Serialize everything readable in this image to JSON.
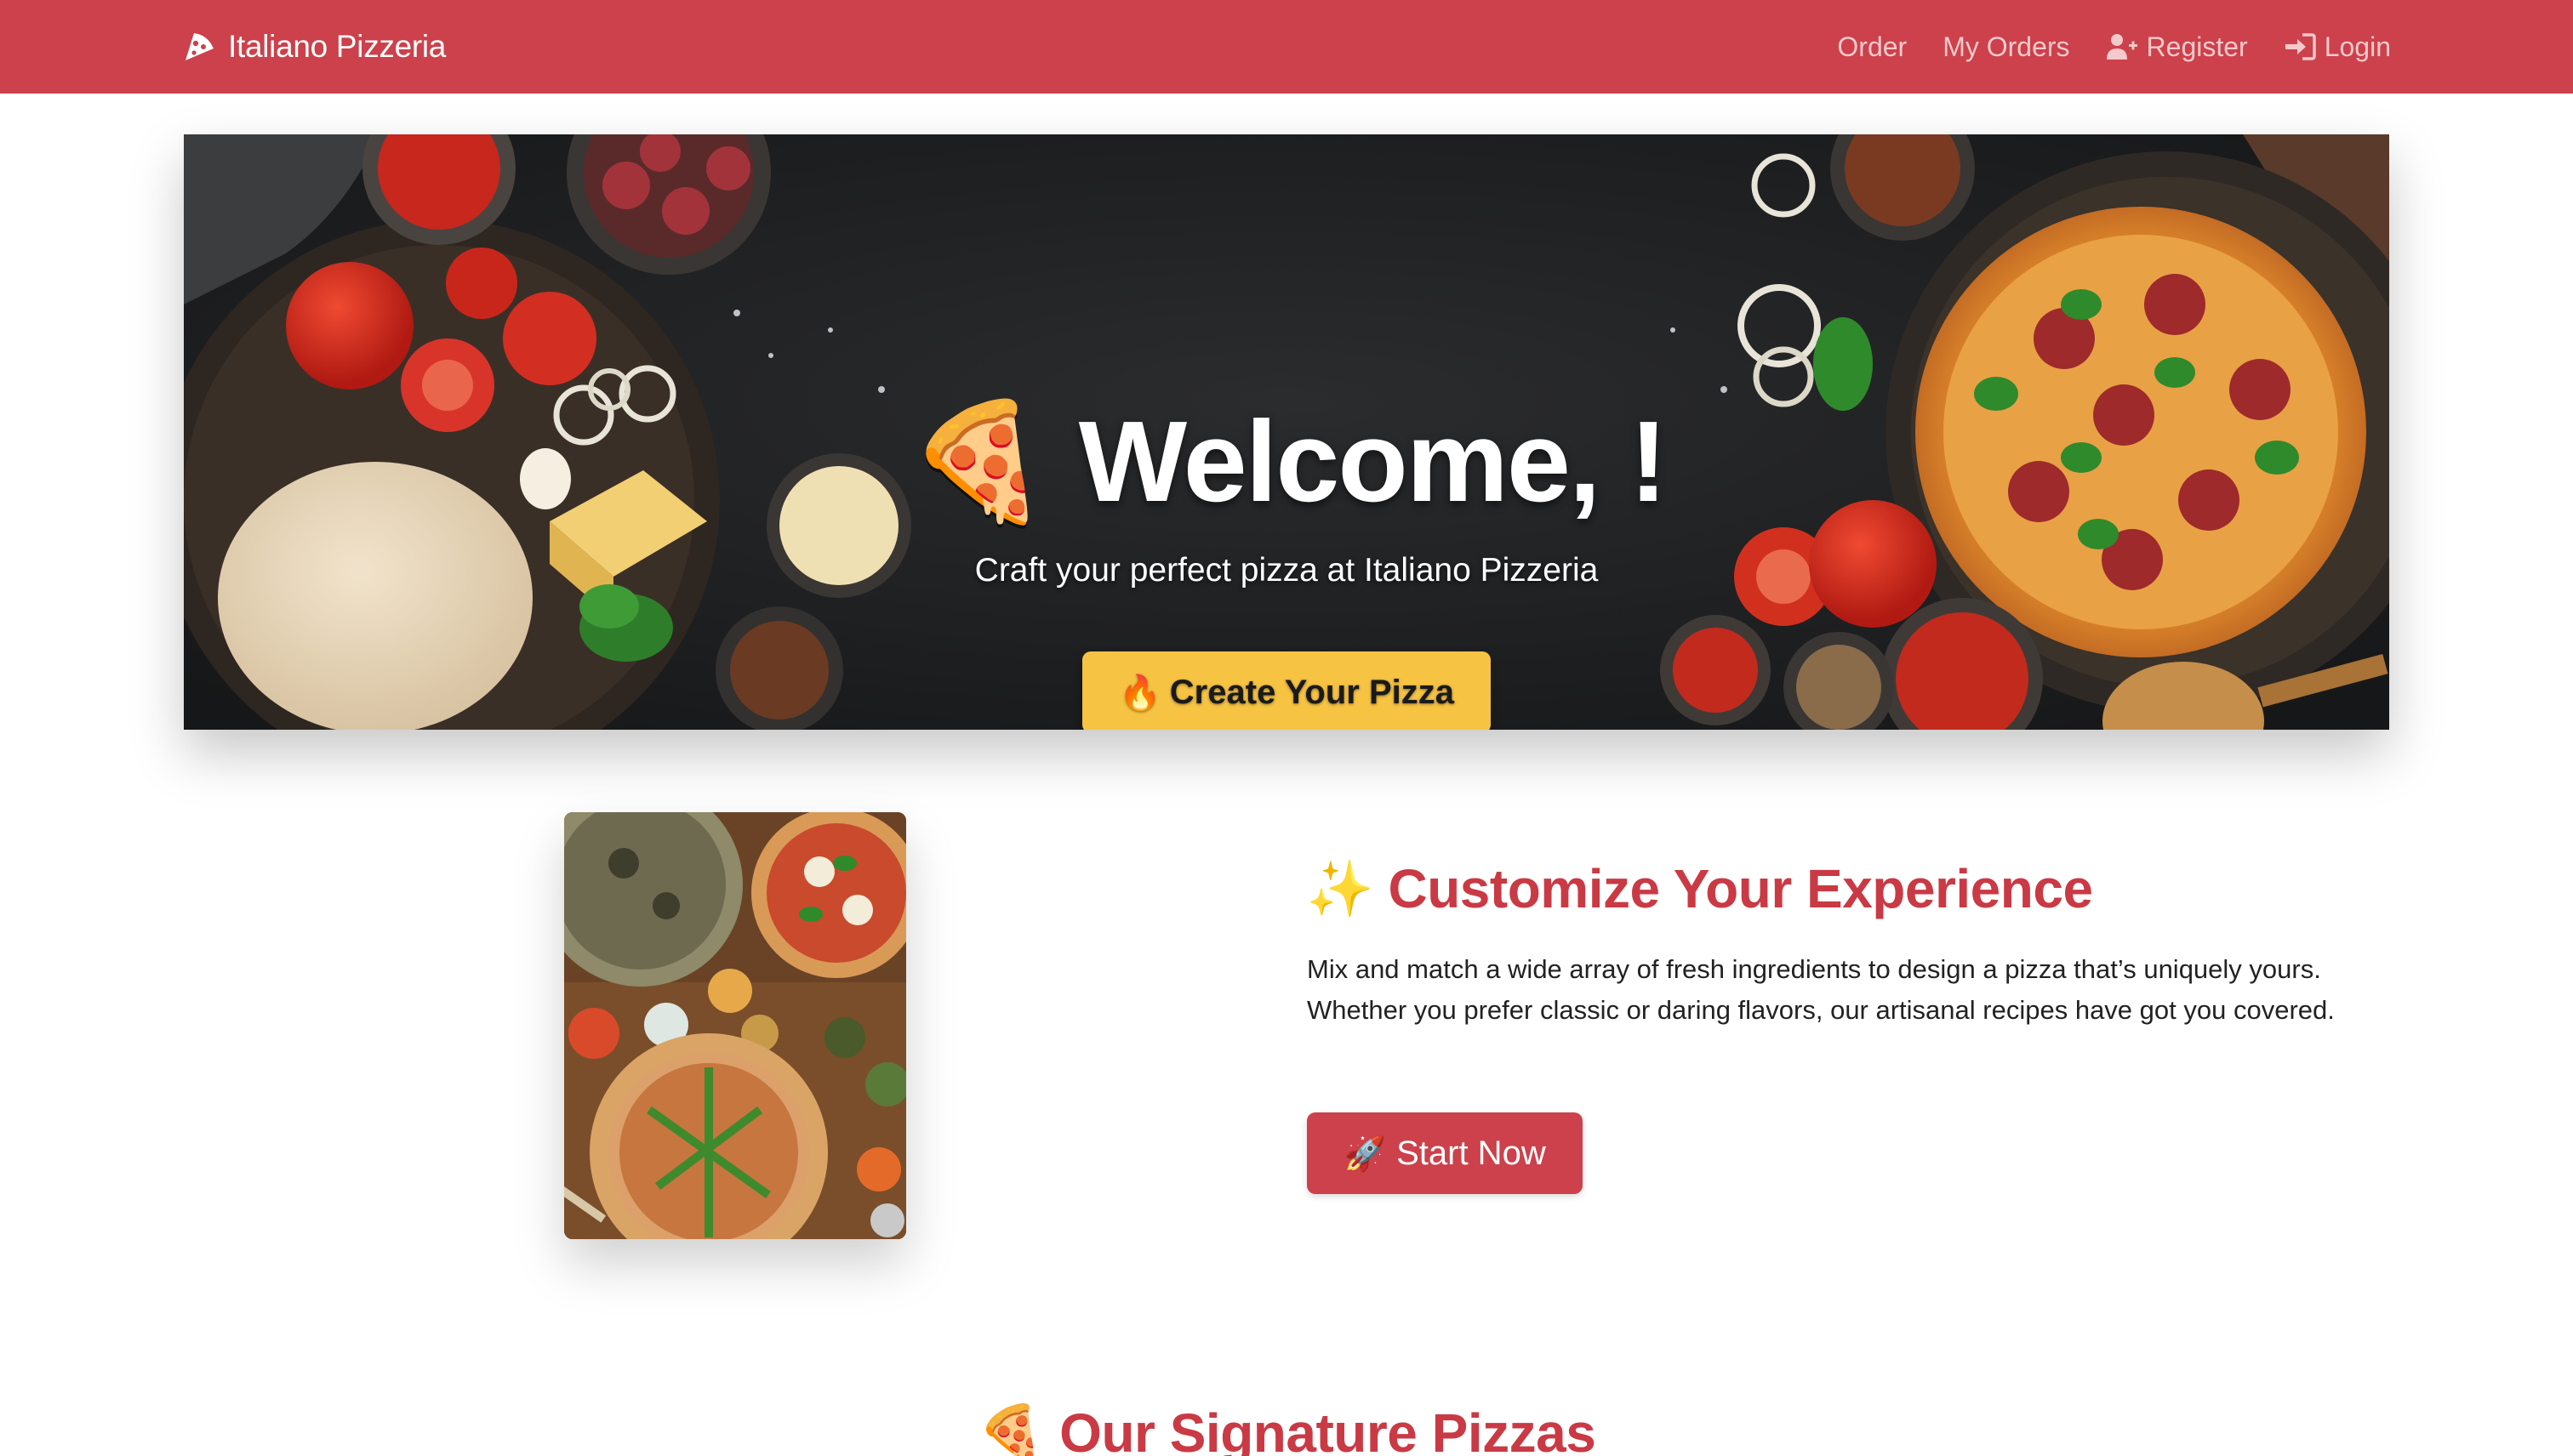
{
  "colors": {
    "primary": "#cc414b",
    "accent": "#f7c343",
    "heading": "#c93a45"
  },
  "navbar": {
    "brand": "Italiano Pizzeria",
    "brand_icon": "pizza-slice-icon",
    "links": [
      {
        "label": "Order"
      },
      {
        "label": "My Orders"
      },
      {
        "label": "Register",
        "icon": "user-plus-icon"
      },
      {
        "label": "Login",
        "icon": "sign-in-icon"
      }
    ]
  },
  "hero": {
    "emoji": "🍕",
    "title": "Welcome, !",
    "subtitle": "Craft your perfect pizza at Italiano Pizzeria",
    "button_emoji": "🔥",
    "button_label": "Create Your Pizza"
  },
  "customize": {
    "emoji": "✨",
    "heading": "Customize Your Experience",
    "text": "Mix and match a wide array of fresh ingredients to design a pizza that’s uniquely yours. Whether you prefer classic or daring flavors, our artisanal recipes have got you covered.",
    "button_emoji": "🚀",
    "button_label": "Start Now"
  },
  "signature": {
    "emoji": "🍕",
    "heading": "Our Signature Pizzas"
  }
}
